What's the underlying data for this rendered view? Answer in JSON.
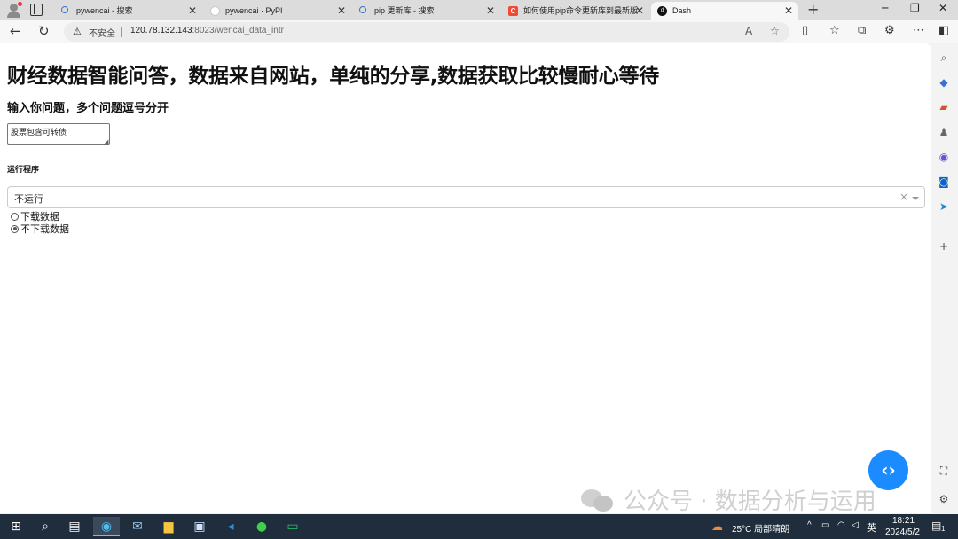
{
  "browser": {
    "tabs": [
      {
        "title": "pywencai - 搜索",
        "favicon": "search-icon"
      },
      {
        "title": "pywencai · PyPI",
        "favicon": "pypi-icon"
      },
      {
        "title": "pip 更新库 - 搜索",
        "favicon": "search-icon"
      },
      {
        "title": "如何使用pip命令更新库到最新版",
        "favicon": "csdn-icon"
      },
      {
        "title": "Dash",
        "favicon": "dash-icon"
      }
    ],
    "close_glyph": "✕",
    "new_tab_glyph": "+",
    "security_label": "不安全",
    "url_host": "120.78.132.143",
    "url_path": ":8023/wencai_data_intr"
  },
  "page": {
    "title": "财经数据智能问答，数据来自网站，单纯的分享,数据获取比较慢耐心等待",
    "question_label": "输入你问题，多个问题逗号分开",
    "question_value": "股票包含可转债",
    "run_label": "运行程序",
    "run_select_value": "不运行",
    "radio_options": [
      {
        "label": "下载数据",
        "checked": false
      },
      {
        "label": "不下载数据",
        "checked": true
      }
    ]
  },
  "watermark": {
    "text": "公众号 · 数据分析与运用"
  },
  "taskbar": {
    "weather": "25°C  局部晴朗",
    "ime": "英",
    "time": "18:21",
    "date": "2024/5/2",
    "notification_count": "1"
  },
  "colors": {
    "accent": "#1a8cff",
    "taskbar": "#1f2d3d"
  }
}
